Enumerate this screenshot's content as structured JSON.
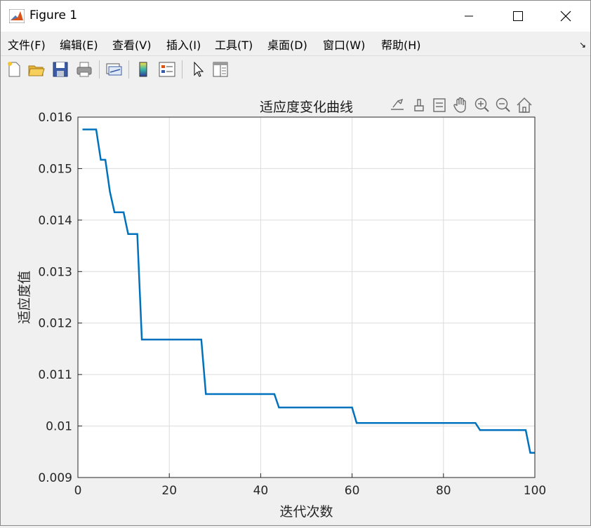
{
  "window": {
    "title": "Figure 1",
    "controls": [
      "minimize",
      "maximize",
      "close"
    ]
  },
  "menu": {
    "items": [
      "文件(F)",
      "编辑(E)",
      "查看(V)",
      "插入(I)",
      "工具(T)",
      "桌面(D)",
      "窗口(W)",
      "帮助(H)"
    ]
  },
  "toolbar": {
    "icons": [
      "new-figure-icon",
      "open-file-icon",
      "save-icon",
      "print-icon",
      "link-plot-icon",
      "colorbar-icon",
      "legend-icon",
      "edit-plot-icon",
      "property-inspector-icon"
    ]
  },
  "axes_toolbar": {
    "icons": [
      "export-icon",
      "brush-icon",
      "datatip-icon",
      "pan-icon",
      "zoom-in-icon",
      "zoom-out-icon",
      "home-icon"
    ]
  },
  "chart_data": {
    "type": "line",
    "title": "适应度变化曲线",
    "xlabel": "迭代次数",
    "ylabel": "适应度值",
    "xlim": [
      0,
      100
    ],
    "ylim": [
      0.009,
      0.016
    ],
    "xticks": [
      "0",
      "20",
      "40",
      "60",
      "80",
      "100"
    ],
    "yticks": [
      "0.009",
      "0.01",
      "0.011",
      "0.012",
      "0.013",
      "0.014",
      "0.015",
      "0.016"
    ],
    "grid": true,
    "line_color": "#0072BD",
    "series": [
      {
        "x": [
          1,
          4,
          5,
          6,
          7,
          8,
          10,
          11,
          13,
          14,
          27,
          28,
          43,
          44,
          60,
          61,
          87,
          88,
          98,
          99,
          100
        ],
        "y": [
          0.01576,
          0.01576,
          0.01517,
          0.01517,
          0.01455,
          0.01415,
          0.01415,
          0.01373,
          0.01373,
          0.01168,
          0.01168,
          0.01062,
          0.01062,
          0.01036,
          0.01036,
          0.01006,
          0.01006,
          0.00992,
          0.00992,
          0.00948,
          0.00948
        ]
      }
    ]
  }
}
